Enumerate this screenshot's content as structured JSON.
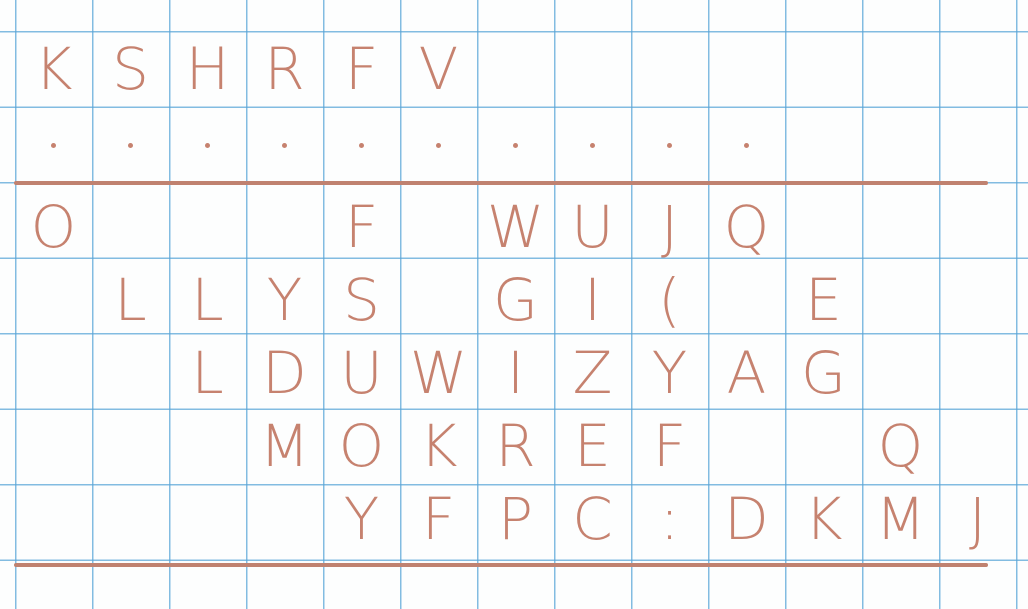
{
  "header": {
    "letters": [
      "K",
      "S",
      "H",
      "R",
      "F",
      "V",
      "",
      "",
      "",
      "",
      "",
      "",
      "",
      ""
    ],
    "dot_row": [
      ".",
      ".",
      ".",
      ".",
      ".",
      ".",
      ".",
      ".",
      ".",
      ".",
      "",
      "",
      "",
      ""
    ]
  },
  "grid": {
    "rows": [
      [
        "O",
        "",
        "",
        "",
        "F",
        "",
        "W",
        "U",
        "J",
        "Q",
        "",
        "",
        "",
        ""
      ],
      [
        "",
        "L",
        "L",
        "Y",
        "S",
        "",
        "G",
        "I",
        "(",
        "",
        "E",
        "",
        "",
        ""
      ],
      [
        "",
        "",
        "L",
        "D",
        "U",
        "W",
        "I",
        "Z",
        "Y",
        "A",
        "G",
        "",
        "",
        ""
      ],
      [
        "",
        "",
        "",
        "M",
        "O",
        "K",
        "R",
        "E",
        "F",
        "",
        "",
        "Q",
        "",
        ""
      ],
      [
        "",
        "",
        "",
        "",
        "Y",
        "F",
        "P",
        "C",
        ":",
        "D",
        "K",
        "M",
        "J",
        ""
      ]
    ]
  },
  "colors": {
    "ink": "#c6826f",
    "rule": "#c08270",
    "grid_line": "#5aa5d7",
    "paper": "#fdfefe"
  }
}
